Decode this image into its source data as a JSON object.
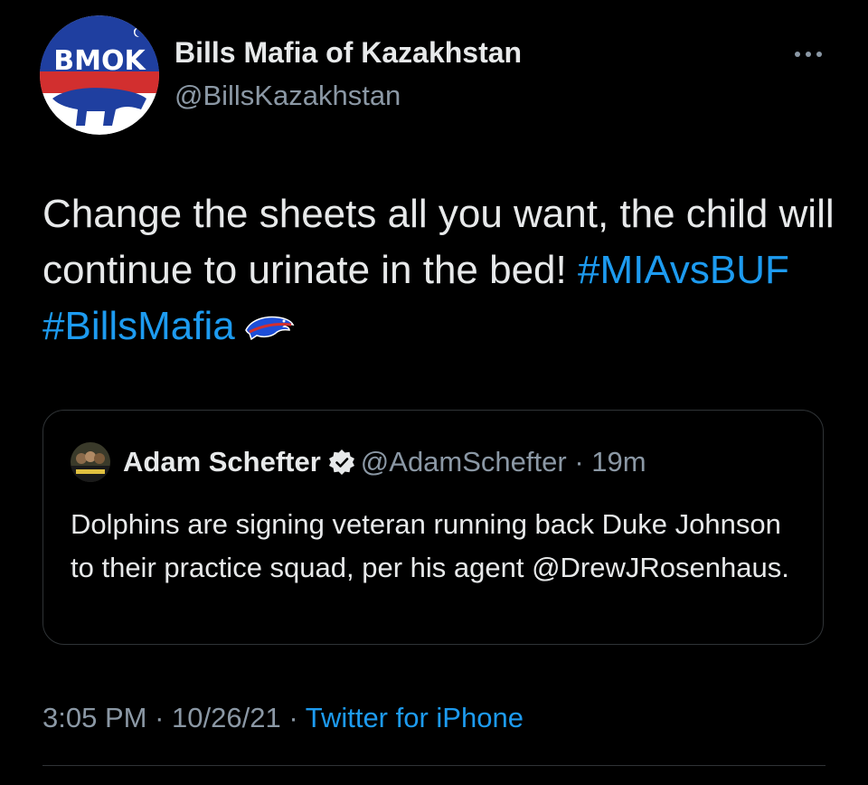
{
  "author": {
    "display_name": "Bills Mafia of Kazakhstan",
    "handle": "@BillsKazakhstan",
    "avatar_text": "BMOK",
    "avatar_icon": "bmok-logo-icon"
  },
  "more_icon": "more-horizontal-icon",
  "tweet": {
    "text_plain": "Change the sheets all you want, the child will continue to urinate in the bed! ",
    "hashtags": [
      "#MIAvsBUF",
      "#BillsMafia"
    ],
    "emoji_icon": "buffalo-bills-logo-icon"
  },
  "quoted_tweet": {
    "display_name": "Adam Schefter",
    "verified_icon": "verified-badge-icon",
    "handle": "@AdamSchefter",
    "separator": "·",
    "time": "19m",
    "text": "Dolphins are signing veteran running back Duke Johnson to their practice squad, per his agent @DrewJRosenhaus."
  },
  "meta": {
    "time": "3:05 PM",
    "date": "10/26/21",
    "separator": "·",
    "source": "Twitter for iPhone"
  },
  "colors": {
    "background": "#000000",
    "primary_text": "#e7e9ea",
    "secondary_text": "#8b98a5",
    "link": "#1d9bf0",
    "border": "#2f3336"
  }
}
